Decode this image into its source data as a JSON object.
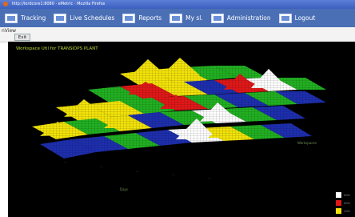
{
  "window": {
    "title": "http://lordcore1:8080 · eMetric · Mozilla Firefox"
  },
  "menu": {
    "items": [
      {
        "label": "Tracking",
        "icon": "tracking-icon"
      },
      {
        "label": "Live Schedules",
        "icon": "schedule-icon"
      },
      {
        "label": "Reports",
        "icon": "reports-icon"
      },
      {
        "label": "My sl.",
        "icon": "my-icon"
      },
      {
        "label": "Administration",
        "icon": "admin-icon"
      },
      {
        "label": "Logout",
        "icon": "logout-icon"
      }
    ]
  },
  "subbar": {
    "label": "nView",
    "button": "Exit"
  },
  "chart": {
    "title": "Workspace Util for TRANSIDPS PLANT",
    "axis_x_label": "Days",
    "axis_z_label": "Workspaces",
    "colors": {
      "white": "#ffffff",
      "red": "#e01818",
      "yellow": "#f2e20a",
      "green": "#22b022",
      "blue": "#1e2fae"
    },
    "legend": [
      {
        "color": "#ffffff",
        "label": "80%"
      },
      {
        "color": "#e01818",
        "label": "60%"
      },
      {
        "color": "#f2e20a",
        "label": "40%"
      }
    ]
  }
}
